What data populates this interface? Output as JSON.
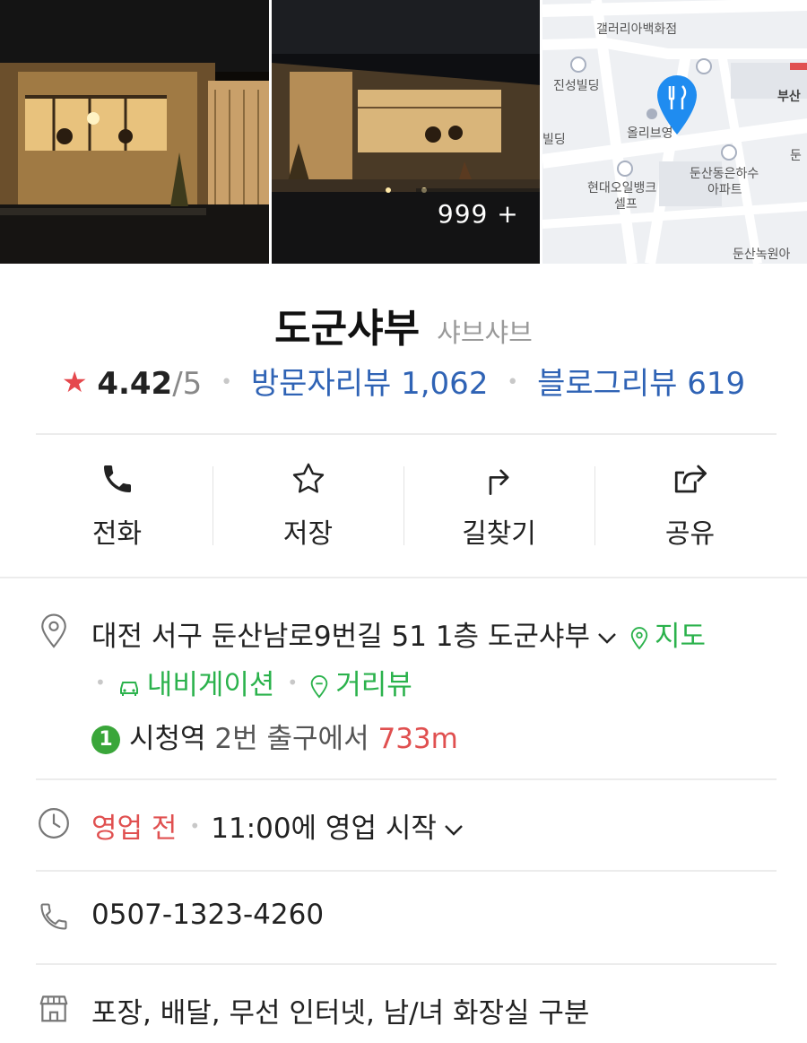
{
  "photos": {
    "count_label": "999 +",
    "map_labels": {
      "dept_store": "갤러리아백화점",
      "jinseong": "진성빌딩",
      "busan": "부산",
      "building": "빌딩",
      "oliveyoung": "올리브영",
      "hyundai_bank": "현대오일뱅크",
      "self": "셀프",
      "apt": "둔산동은하수",
      "apt2": "아파트",
      "dun": "둔",
      "park": "둔산녹원아"
    }
  },
  "place": {
    "name": "도군샤부",
    "category": "샤브샤브"
  },
  "rating": {
    "value": "4.42",
    "max": "/5",
    "visitor_reviews": "방문자리뷰 1,062",
    "blog_reviews": "블로그리뷰 619"
  },
  "actions": [
    {
      "label": "전화",
      "icon": "phone-icon"
    },
    {
      "label": "저장",
      "icon": "star-outline-icon"
    },
    {
      "label": "길찾기",
      "icon": "directions-icon"
    },
    {
      "label": "공유",
      "icon": "share-icon"
    }
  ],
  "info": {
    "address": "대전 서구 둔산남로9번길 51 1층 도군샤부",
    "map_link": "지도",
    "navigation_link": "내비게이션",
    "streetview_link": "거리뷰",
    "subway_line": "1",
    "subway_station": "시청역",
    "subway_exit": "2번 출구에서",
    "subway_distance": "733m",
    "hours_status": "영업 전",
    "hours_detail": "11:00에 영업 시작",
    "phone": "0507-1323-4260",
    "amenities": "포장, 배달, 무선 인터넷, 남/녀 화장실 구분"
  },
  "colors": {
    "link_blue": "#2f63b5",
    "green": "#2bb24c",
    "red": "#e05050",
    "star_red": "#e5484d",
    "map_pin": "#1f8cf0"
  }
}
